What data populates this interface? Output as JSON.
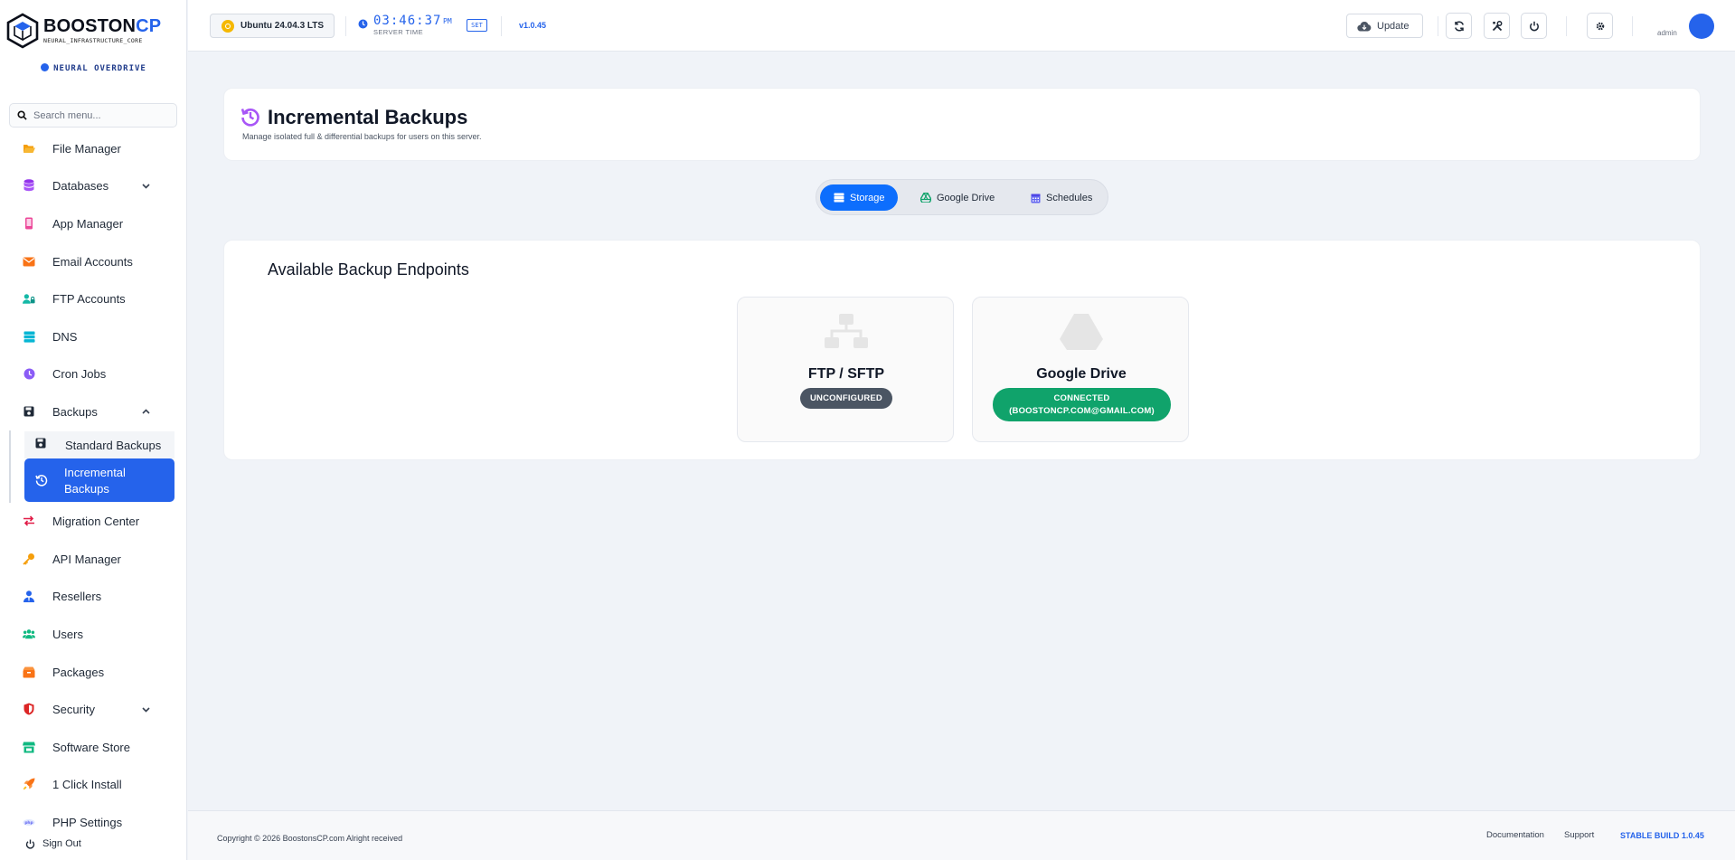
{
  "brand": {
    "name_main": "BOOSTON",
    "name_accent": "CP",
    "tagline": "NEURAL_INFRASTRUCTURE_CORE",
    "mode": "NEURAL OVERDRIVE",
    "accent_color": "#2563eb"
  },
  "search": {
    "placeholder": "Search menu..."
  },
  "sidebar": {
    "items": [
      {
        "label": "File Manager",
        "icon": "folder-open-icon"
      },
      {
        "label": "Databases",
        "icon": "database-icon"
      },
      {
        "label": "App Manager",
        "icon": "app-icon"
      },
      {
        "label": "Email Accounts",
        "icon": "envelope-icon"
      },
      {
        "label": "FTP Accounts",
        "icon": "user-lock-icon"
      },
      {
        "label": "DNS",
        "icon": "server-icon"
      },
      {
        "label": "Cron Jobs",
        "icon": "clock-icon"
      },
      {
        "label": "Backups",
        "icon": "save-icon"
      },
      {
        "label": "Migration Center",
        "icon": "exchange-icon"
      },
      {
        "label": "API Manager",
        "icon": "key-icon"
      },
      {
        "label": "Resellers",
        "icon": "user-tie-icon"
      },
      {
        "label": "Users",
        "icon": "users-icon"
      },
      {
        "label": "Packages",
        "icon": "box-icon"
      },
      {
        "label": "Security",
        "icon": "shield-icon"
      },
      {
        "label": "Software Store",
        "icon": "store-icon"
      },
      {
        "label": "1 Click Install",
        "icon": "rocket-icon"
      },
      {
        "label": "PHP Settings",
        "icon": "php-icon"
      }
    ],
    "backups_sub": [
      {
        "label": "Standard Backups",
        "icon": "save-icon"
      },
      {
        "label": "Incremental Backups",
        "icon": "history-icon",
        "active": true
      }
    ],
    "signout": "Sign Out"
  },
  "topbar": {
    "os": "Ubuntu 24.04.3 LTS",
    "time": "03:46:37",
    "ampm": "PM",
    "time_label": "SERVER TIME",
    "set_label": "SET",
    "version": "v1.0.45",
    "update_label": "Update",
    "user": "admin"
  },
  "page": {
    "title": "Incremental Backups",
    "subtitle": "Manage isolated full & differential backups for users on this server."
  },
  "tabs": [
    {
      "label": "Storage",
      "icon": "storage-icon",
      "active": true
    },
    {
      "label": "Google Drive",
      "icon": "google-drive-icon"
    },
    {
      "label": "Schedules",
      "icon": "calendar-icon"
    }
  ],
  "endpoints": {
    "title": "Available Backup Endpoints",
    "cards": [
      {
        "name": "FTP / SFTP",
        "status": "UNCONFIGURED",
        "status_color": "#4b5563"
      },
      {
        "name": "Google Drive",
        "status_line1": "CONNECTED",
        "status_line2": "(BOOSTONCP.COM@GMAIL.COM)",
        "status_color": "#10a36b"
      }
    ]
  },
  "footer": {
    "copyright": "Copyright © 2026 BoostonsCP.com Alright received",
    "documentation": "Documentation",
    "support": "Support",
    "build": "STABLE BUILD 1.0.45"
  }
}
